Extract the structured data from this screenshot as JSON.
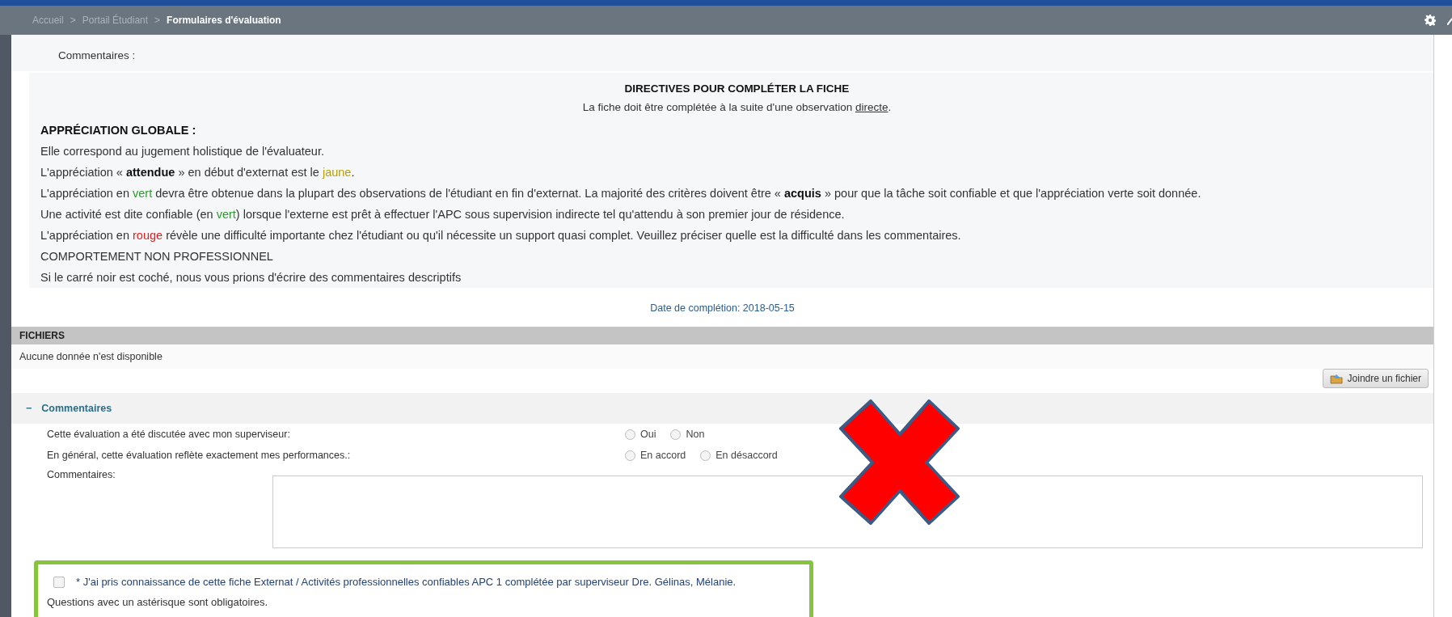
{
  "breadcrumb": [
    {
      "label": "Accueil",
      "current": false
    },
    {
      "label": "Portail Étudiant",
      "current": false
    },
    {
      "label": "Formulaires d'évaluation",
      "current": true
    }
  ],
  "breadcrumb_separator": ">",
  "comments_label": "Commentaires :",
  "directives": {
    "title": "DIRECTIVES POUR COMPLÉTER LA FICHE",
    "subtitle": [
      {
        "text": "La fiche doit être complétée à la suite d'une observation ",
        "kind": "plain"
      },
      {
        "text": "directe",
        "kind": "underline"
      },
      {
        "text": ".",
        "kind": "plain"
      }
    ],
    "lines": [
      [
        {
          "text": "APPRÉCIATION GLOBALE :",
          "kind": "bold"
        }
      ],
      [
        {
          "text": "Elle correspond au jugement holistique de l'évaluateur.",
          "kind": "plain"
        }
      ],
      [
        {
          "text": "L'appréciation « ",
          "kind": "plain"
        },
        {
          "text": "attendue",
          "kind": "bold"
        },
        {
          "text": " » en début d'externat est le ",
          "kind": "plain"
        },
        {
          "text": "jaune",
          "kind": "yellow"
        },
        {
          "text": ".",
          "kind": "plain"
        }
      ],
      [
        {
          "text": "L'appréciation en ",
          "kind": "plain"
        },
        {
          "text": "vert",
          "kind": "green"
        },
        {
          "text": " devra être obtenue dans la plupart des observations de l'étudiant en fin d'externat. La majorité des critères doivent être « ",
          "kind": "plain"
        },
        {
          "text": "acquis",
          "kind": "bold"
        },
        {
          "text": " » pour que la tâche soit confiable et que l'appréciation verte soit donnée.",
          "kind": "plain"
        }
      ],
      [
        {
          "text": "Une activité est dite confiable (en ",
          "kind": "plain"
        },
        {
          "text": "vert",
          "kind": "green"
        },
        {
          "text": ") lorsque l'externe est prêt à effectuer l'APC sous supervision indirecte tel qu'attendu à son premier jour de résidence.",
          "kind": "plain"
        }
      ],
      [
        {
          "text": "L'appréciation en ",
          "kind": "plain"
        },
        {
          "text": "rouge",
          "kind": "red"
        },
        {
          "text": " révèle une difficulté importante chez l'étudiant ou qu'il nécessite un support quasi complet. Veuillez préciser quelle est la difficulté dans les commentaires.",
          "kind": "plain"
        }
      ],
      [
        {
          "text": "COMPORTEMENT NON PROFESSIONNEL",
          "kind": "plain"
        }
      ],
      [
        {
          "text": "Si le carré noir est coché, nous vous prions d'écrire des commentaires descriptifs",
          "kind": "plain"
        }
      ]
    ]
  },
  "completion_date": "Date de complétion: 2018-05-15",
  "files": {
    "title": "FICHIERS",
    "empty_message": "Aucune donnée n'est disponible",
    "attach_button": "Joindre un fichier"
  },
  "comments": {
    "toggle": "−",
    "title": "Commentaires",
    "questions": [
      {
        "label": "Cette évaluation a été discutée avec mon superviseur:",
        "options": [
          {
            "label": "Oui",
            "selected": false
          },
          {
            "label": "Non",
            "selected": false
          }
        ]
      },
      {
        "label": "En général, cette évaluation reflète exactement mes performances.:",
        "options": [
          {
            "label": "En accord",
            "selected": false
          },
          {
            "label": "En désaccord",
            "selected": false
          }
        ]
      }
    ],
    "comment_label": "Commentaires:"
  },
  "acknowledgement": {
    "checked": false,
    "text": "* J'ai pris connaissance de cette fiche Externat / Activités professionnelles confiables APC 1 complétée par superviseur Dre. Gélinas, Mélanie."
  },
  "required_note": "Questions avec un astérisque sont obligatoires."
}
